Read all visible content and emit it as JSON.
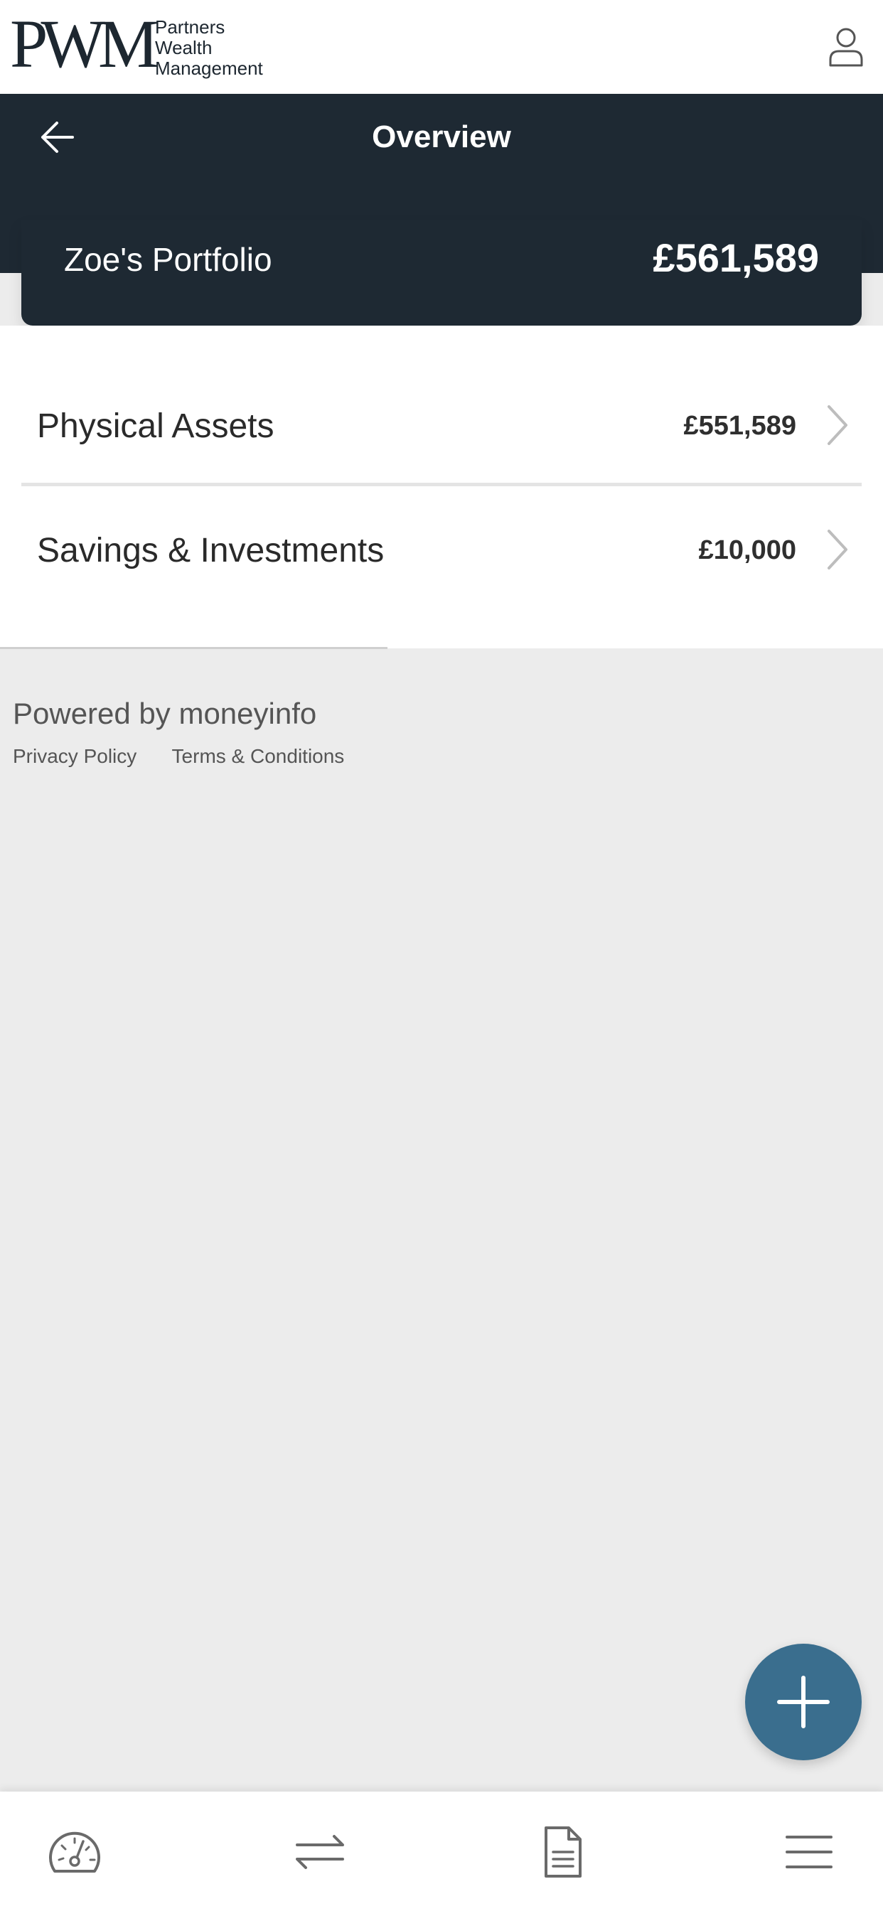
{
  "brand": {
    "mark": "PWM",
    "lines": [
      "Partners",
      "Wealth",
      "Management"
    ]
  },
  "header": {
    "title": "Overview",
    "back_icon": "arrow-left-icon",
    "profile_icon": "user-icon"
  },
  "portfolio": {
    "name": "Zoe's Portfolio",
    "total": "£561,589"
  },
  "categories": [
    {
      "label": "Physical Assets",
      "value": "£551,589"
    },
    {
      "label": "Savings & Investments",
      "value": "£10,000"
    }
  ],
  "footer": {
    "powered_by": "Powered by moneyinfo",
    "links": [
      "Privacy Policy",
      "Terms & Conditions"
    ]
  },
  "fab": {
    "icon": "plus-icon"
  },
  "bottom_nav": [
    {
      "icon": "dashboard-gauge-icon"
    },
    {
      "icon": "transfer-arrows-icon"
    },
    {
      "icon": "document-icon"
    },
    {
      "icon": "menu-icon"
    }
  ],
  "colors": {
    "header_bg": "#1e2933",
    "fab_bg": "#3a6e8e",
    "page_bg": "#ececec"
  }
}
